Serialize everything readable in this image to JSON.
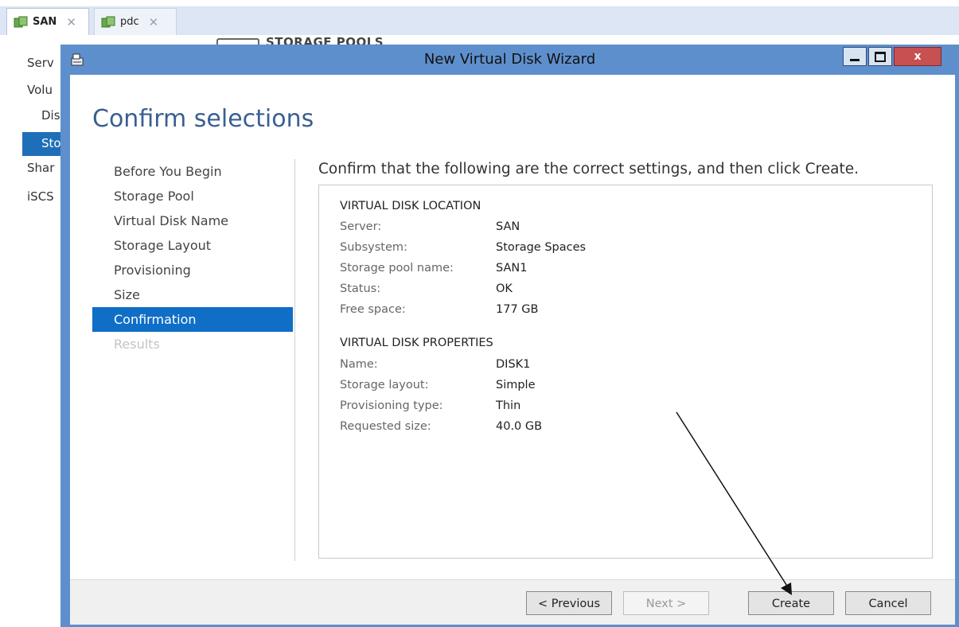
{
  "outer_tabs": [
    {
      "label": "SAN",
      "active": true
    },
    {
      "label": "pdc",
      "active": false
    }
  ],
  "background": {
    "header": "STORAGE POOLS",
    "nav_items": [
      "Serv",
      "Volu",
      "Dis",
      "Sto",
      "Shar",
      "iSCS"
    ]
  },
  "wizard": {
    "title": "New Virtual Disk Wizard",
    "heading": "Confirm selections",
    "steps": [
      {
        "label": "Before You Begin",
        "state": "normal"
      },
      {
        "label": "Storage Pool",
        "state": "normal"
      },
      {
        "label": "Virtual Disk Name",
        "state": "normal"
      },
      {
        "label": "Storage Layout",
        "state": "normal"
      },
      {
        "label": "Provisioning",
        "state": "normal"
      },
      {
        "label": "Size",
        "state": "normal"
      },
      {
        "label": "Confirmation",
        "state": "active"
      },
      {
        "label": "Results",
        "state": "disabled"
      }
    ],
    "instruction": "Confirm that the following are the correct settings, and then click Create.",
    "location_section": {
      "title": "VIRTUAL DISK LOCATION",
      "rows": [
        {
          "label": "Server:",
          "value": "SAN"
        },
        {
          "label": "Subsystem:",
          "value": "Storage Spaces"
        },
        {
          "label": "Storage pool name:",
          "value": "SAN1"
        },
        {
          "label": "Status:",
          "value": "OK"
        },
        {
          "label": "Free space:",
          "value": "177 GB"
        }
      ]
    },
    "properties_section": {
      "title": "VIRTUAL DISK PROPERTIES",
      "rows": [
        {
          "label": "Name:",
          "value": "DISK1"
        },
        {
          "label": "Storage layout:",
          "value": "Simple"
        },
        {
          "label": "Provisioning type:",
          "value": "Thin"
        },
        {
          "label": "Requested size:",
          "value": "40.0 GB"
        }
      ]
    },
    "buttons": {
      "previous": "< Previous",
      "next": "Next >",
      "create": "Create",
      "cancel": "Cancel"
    },
    "window_controls": {
      "close": "x"
    }
  },
  "colors": {
    "accent": "#0f6ec6",
    "heading": "#3a5f92",
    "window_frame": "#5e8fcd",
    "close_button": "#c75050"
  }
}
